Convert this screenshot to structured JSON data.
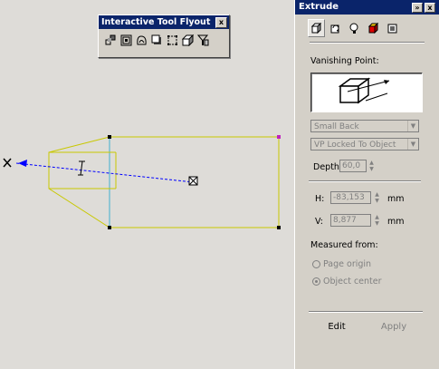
{
  "flyout": {
    "title": "Interactive Tool Flyout",
    "close": "x",
    "tools": [
      "blend-tool-icon",
      "contour-tool-icon",
      "distort-tool-icon",
      "drop-shadow-tool-icon",
      "envelope-tool-icon",
      "extrude-tool-icon",
      "transparency-tool-icon"
    ]
  },
  "docker": {
    "title": "Extrude",
    "title_buttons": [
      "»",
      "x"
    ],
    "tabs": [
      "extrude-depth-tab-icon",
      "extrude-rotation-tab-icon",
      "extrude-lighting-tab-icon",
      "extrude-color-tab-icon",
      "extrude-bevel-tab-icon"
    ],
    "vanishing_point_label": "Vanishing Point:",
    "extrusion_type": "Small Back",
    "vp_mode": "VP Locked To Object",
    "depth_label": "Depth:",
    "depth_value": "60,0",
    "h_label": "H:",
    "h_value": "-83,153",
    "v_label": "V:",
    "v_value": "8,877",
    "unit": "mm",
    "measured_from_label": "Measured from:",
    "options": [
      "Page origin",
      "Object center"
    ],
    "selected_option": "Object center",
    "edit_label": "Edit",
    "apply_label": "Apply"
  },
  "colors": {
    "extrude_outline": "#c8c800",
    "bbox_line": "#40b0d0",
    "vanishing_vector": "#0000ff",
    "canvas": "#dedcd8"
  }
}
